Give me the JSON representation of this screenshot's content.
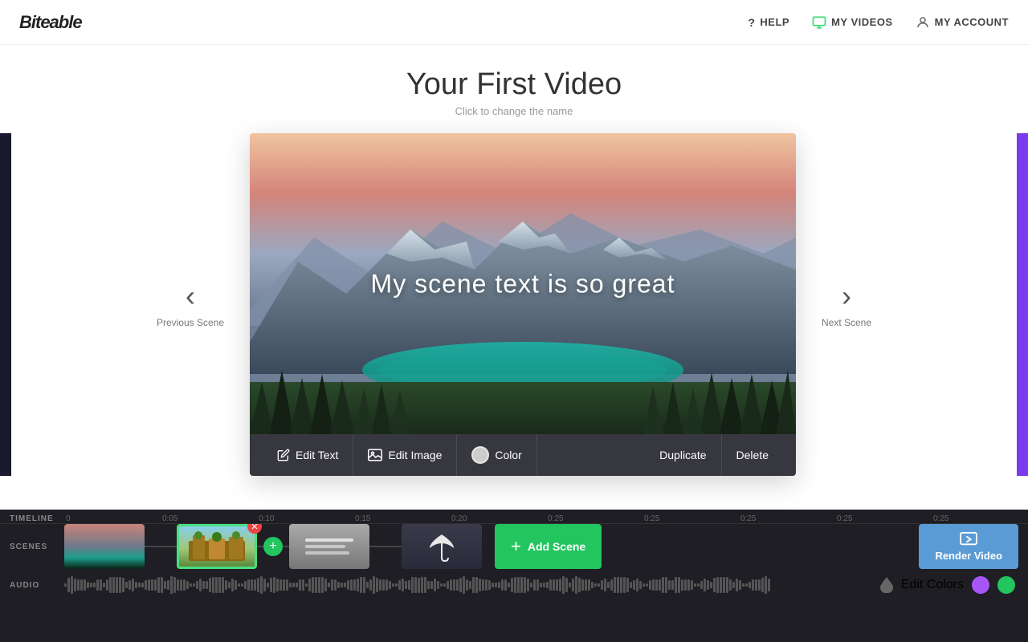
{
  "header": {
    "logo": "Biteable",
    "nav": [
      {
        "id": "help",
        "label": "HELP",
        "icon": "help-icon"
      },
      {
        "id": "my-videos",
        "label": "MY VIDEOS",
        "icon": "videos-icon"
      },
      {
        "id": "my-account",
        "label": "MY ACCOUNT",
        "icon": "account-icon"
      }
    ]
  },
  "video": {
    "title": "Your First Video",
    "subtitle": "Click to change the name"
  },
  "scene": {
    "text": "My scene text is so great",
    "prev_label": "Previous Scene",
    "next_label": "Next Scene"
  },
  "toolbar": {
    "edit_text_label": "Edit Text",
    "edit_image_label": "Edit Image",
    "color_label": "Color",
    "duplicate_label": "Duplicate",
    "delete_label": "Delete"
  },
  "timeline": {
    "label": "TIMELINE",
    "ticks": [
      "0",
      "0:05",
      "0:10",
      "0:15",
      "0:20",
      "0:25",
      "0:25",
      "0:25",
      "0:25",
      "0:25"
    ]
  },
  "scenes_row": {
    "label": "SCENES",
    "add_label": "Add Scene",
    "render_label": "Render Video"
  },
  "audio_row": {
    "label": "AUDIO"
  },
  "edit_colors": {
    "label": "Edit Colors",
    "color1": "#a855f7",
    "color2": "#22c55e"
  }
}
